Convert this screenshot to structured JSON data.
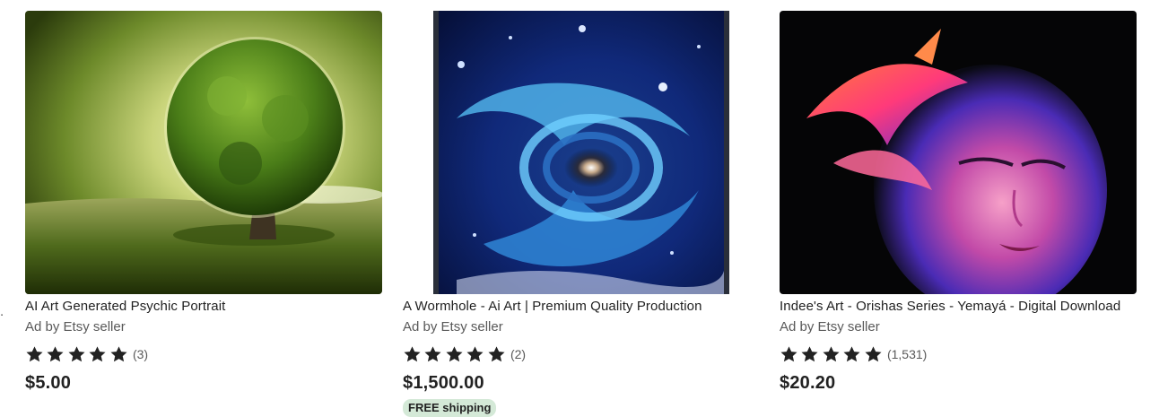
{
  "edge_fragment": ".",
  "listings": [
    {
      "title": "AI Art Generated Psychic Portrait",
      "ad_label": "Ad by Etsy seller",
      "rating_stars": 5,
      "review_count": "(3)",
      "price": "$5.00",
      "image_icon": "tree-artwork-image"
    },
    {
      "title": "A Wormhole - Ai Art | Premium Quality Production",
      "ad_label": "Ad by Etsy seller",
      "rating_stars": 5,
      "review_count": "(2)",
      "price": "$1,500.00",
      "shipping_badge": "FREE shipping",
      "image_icon": "wormhole-artwork-image"
    },
    {
      "title": "Indee's Art - Orishas Series - Yemayá - Digital Download",
      "ad_label": "Ad by Etsy seller",
      "rating_stars": 5,
      "review_count": "(1,531)",
      "price": "$20.20",
      "image_icon": "neon-face-artwork-image"
    }
  ],
  "colors": {
    "text": "#222222",
    "muted": "#595959",
    "badge_bg": "#d4e9d7",
    "star": "#222222"
  }
}
